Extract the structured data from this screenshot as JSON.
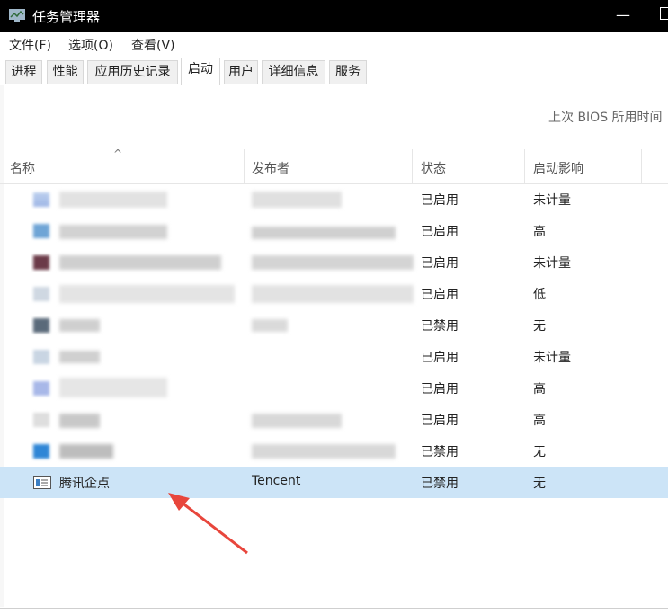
{
  "window": {
    "title": "任务管理器"
  },
  "menu": {
    "file": "文件(F)",
    "options": "选项(O)",
    "view": "查看(V)"
  },
  "tabs": [
    "进程",
    "性能",
    "应用历史记录",
    "启动",
    "用户",
    "详细信息",
    "服务"
  ],
  "active_tab": "启动",
  "bios_label": "上次 BIOS 所用时间",
  "columns": {
    "name": "名称",
    "publisher": "发布者",
    "status": "状态",
    "impact": "启动影响"
  },
  "rows": [
    {
      "name": "",
      "publisher": "",
      "status": "已启用",
      "impact": "未计量"
    },
    {
      "name": "",
      "publisher": "",
      "status": "已启用",
      "impact": "高"
    },
    {
      "name": "",
      "publisher": "",
      "status": "已启用",
      "impact": "未计量"
    },
    {
      "name": "",
      "publisher": "",
      "status": "已启用",
      "impact": "低"
    },
    {
      "name": "",
      "publisher": "",
      "status": "已禁用",
      "impact": "无"
    },
    {
      "name": "",
      "publisher": "",
      "status": "已启用",
      "impact": "未计量"
    },
    {
      "name": "",
      "publisher": "",
      "status": "已启用",
      "impact": "高"
    },
    {
      "name": "",
      "publisher": "",
      "status": "已启用",
      "impact": "高"
    },
    {
      "name": "",
      "publisher": "",
      "status": "已禁用",
      "impact": "无"
    },
    {
      "name": "腾讯企点",
      "publisher": "Tencent",
      "status": "已禁用",
      "impact": "无"
    }
  ],
  "colors": {
    "selected_row": "#cce4f7",
    "arrow": "#e8463c"
  }
}
